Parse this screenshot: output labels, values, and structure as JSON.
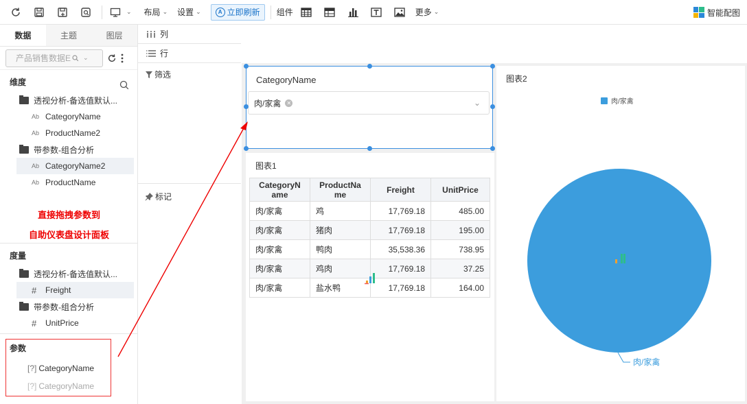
{
  "toolbar": {
    "layout": "布局",
    "settings": "设置",
    "refresh": "立即刷新",
    "components": "组件",
    "more": "更多",
    "smart_match": "智能配图"
  },
  "left": {
    "tabs": [
      "数据",
      "主题",
      "图层"
    ],
    "dataset_placeholder": "产品销售数据E",
    "dimensions_title": "维度",
    "dimensions": [
      {
        "folder": "透视分析-备选值默认...",
        "fields": [
          "CategoryName",
          "ProductName2"
        ]
      },
      {
        "folder": "带参数-组合分析",
        "fields": [
          "CategoryName2",
          "ProductName"
        ]
      }
    ],
    "field_type_text": "Ab",
    "annotation_line1": "直接拖拽参数到",
    "annotation_line2": "自助仪表盘设计面板",
    "measures_title": "度量",
    "measures": [
      {
        "folder": "透视分析-备选值默认...",
        "fields": [
          "Freight"
        ]
      },
      {
        "folder": "带参数-组合分析",
        "fields": [
          "UnitPrice"
        ]
      }
    ],
    "field_type_num": "#",
    "params_title": "参数",
    "param_prefix": "[?]",
    "params": [
      "CategoryName",
      "CategoryName"
    ]
  },
  "config": {
    "columns": "列",
    "rows": "行",
    "filter": "筛选",
    "marks": "标记"
  },
  "filter_card": {
    "title": "CategoryName",
    "selected": "肉/家禽"
  },
  "table_card": {
    "title": "图表1",
    "headers": [
      "CategoryN\name",
      "ProductNa\nme",
      "Freight",
      "UnitPrice"
    ],
    "rows": [
      [
        "肉/家禽",
        "鸡",
        "17,769.18",
        "485.00"
      ],
      [
        "肉/家禽",
        "猪肉",
        "17,769.18",
        "195.00"
      ],
      [
        "肉/家禽",
        "鸭肉",
        "35,538.36",
        "738.95"
      ],
      [
        "肉/家禽",
        "鸡肉",
        "17,769.18",
        "37.25"
      ],
      [
        "肉/家禽",
        "盐水鸭",
        "17,769.18",
        "164.00"
      ]
    ]
  },
  "chart_data": {
    "type": "pie",
    "title": "图表2",
    "categories": [
      "肉/家禽"
    ],
    "values": [
      100
    ],
    "colors": [
      "#3c9ddd"
    ],
    "legend": "top-center",
    "slice_labels": [
      "肉/家禽"
    ]
  },
  "colors": {
    "accent": "#3b8fe0",
    "annotation": "#e00000",
    "pie": "#3c9ddd"
  }
}
